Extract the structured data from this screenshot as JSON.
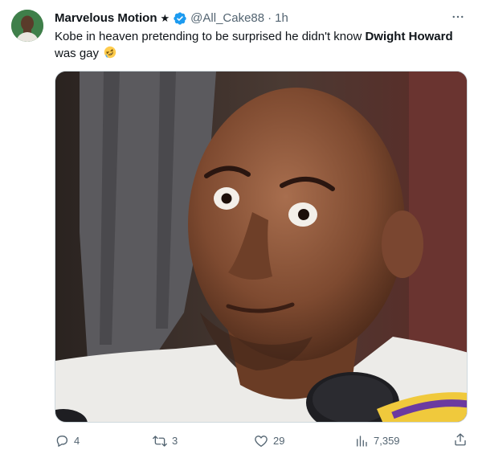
{
  "tweet": {
    "display_name": "Marvelous Motion",
    "name_symbol": "★",
    "handle": "@All_Cake88",
    "separator": "·",
    "time": "1h",
    "text_before": "Kobe in heaven pretending to be surprised he didn't know ",
    "text_bold": "Dwight Howard",
    "text_after": " was gay"
  },
  "actions": {
    "replies": "4",
    "reposts": "3",
    "likes": "29",
    "views": "7,359"
  },
  "colors": {
    "verified": "#1d9bf0",
    "secondary_text": "#536471",
    "primary_text": "#0f1419"
  },
  "icons": [
    "verified-badge-icon",
    "more-icon",
    "reply-icon",
    "repost-icon",
    "like-icon",
    "views-icon",
    "share-icon",
    "rofl-emoji-icon"
  ]
}
